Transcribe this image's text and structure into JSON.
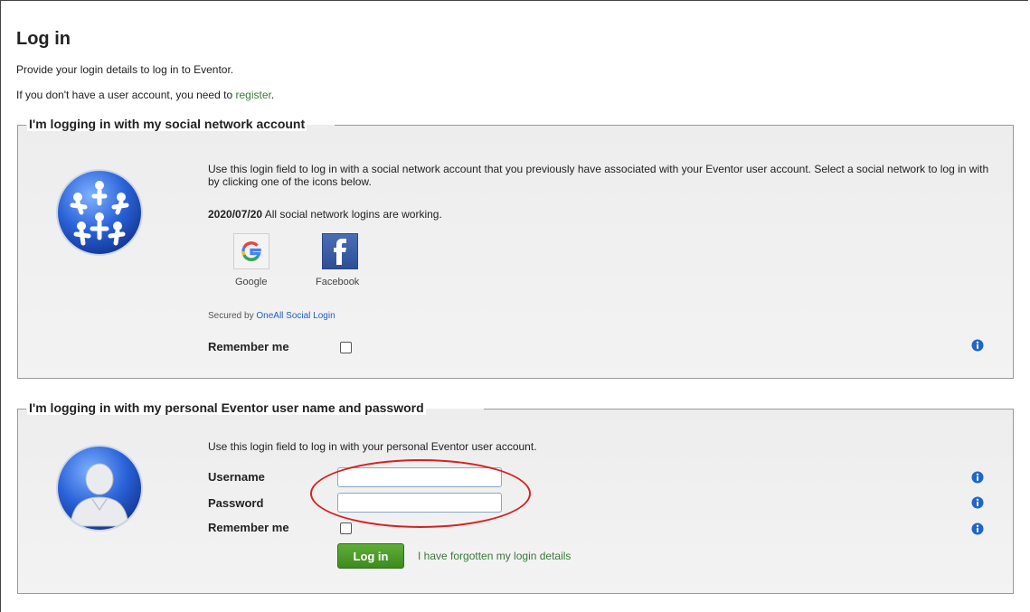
{
  "page": {
    "title": "Log in",
    "intro": "Provide your login details to log in to Eventor.",
    "register_prefix": "If you don't have a user account, you need to ",
    "register_link": "register",
    "register_suffix": "."
  },
  "social": {
    "legend": "I'm logging in with my social network account",
    "description": "Use this login field to log in with a social network account that you previously have associated with your Eventor user account. Select a social network to log in with by clicking one of the icons below.",
    "status_date": "2020/07/20",
    "status_text": " All social network logins are working.",
    "providers": [
      {
        "label": "Google"
      },
      {
        "label": "Facebook"
      }
    ],
    "secured_prefix": "Secured by ",
    "secured_link": "OneAll Social Login",
    "remember_label": "Remember me"
  },
  "personal": {
    "legend": "I'm logging in with my personal Eventor user name and password",
    "description": "Use this login field to log in with your personal Eventor user account.",
    "username_label": "Username",
    "username_value": "",
    "password_label": "Password",
    "password_value": "",
    "remember_label": "Remember me",
    "login_button": "Log in",
    "forgot_link": "I have forgotten my login details"
  },
  "colors": {
    "link": "#3a7a3a",
    "login_button": "#4e9c2c",
    "highlight": "#d82020",
    "info": "#1f66c8"
  }
}
